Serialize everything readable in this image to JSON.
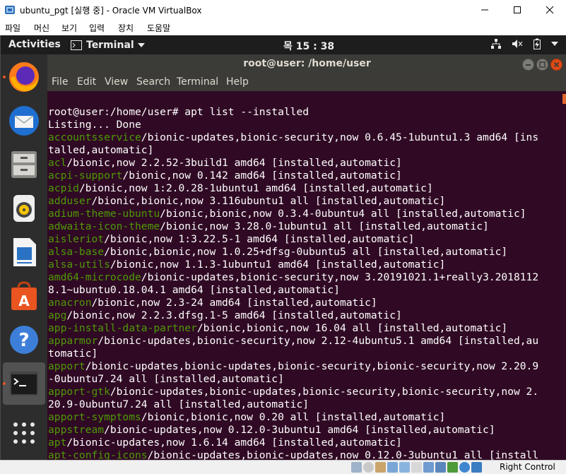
{
  "vbox": {
    "title": "ubuntu_pgt [실행 중] - Oracle VM VirtualBox",
    "menu": [
      "파일",
      "머신",
      "보기",
      "입력",
      "장치",
      "도움말"
    ],
    "host_key": "Right Control"
  },
  "gnome": {
    "activities": "Activities",
    "app_menu": "Terminal",
    "clock": "목 15 : 38"
  },
  "dock": {
    "items": [
      "firefox-icon",
      "thunderbird-icon",
      "files-icon",
      "rhythmbox-icon",
      "libreoffice-writer-icon",
      "ubuntu-software-icon",
      "help-icon",
      "terminal-icon",
      "show-applications-icon"
    ]
  },
  "terminal": {
    "title": "root@user: /home/user",
    "menu": [
      "File",
      "Edit",
      "View",
      "Search",
      "Terminal",
      "Help"
    ],
    "lines": [
      {
        "pkg": "",
        "rest": "root@user:/home/user# apt list --installed"
      },
      {
        "pkg": "",
        "rest": "Listing... Done"
      },
      {
        "pkg": "accountsservice",
        "rest": "/bionic-updates,bionic-security,now 0.6.45-1ubuntu1.3 amd64 [ins"
      },
      {
        "pkg": "",
        "rest": "talled,automatic]"
      },
      {
        "pkg": "acl",
        "rest": "/bionic,now 2.2.52-3build1 amd64 [installed,automatic]"
      },
      {
        "pkg": "acpi-support",
        "rest": "/bionic,now 0.142 amd64 [installed,automatic]"
      },
      {
        "pkg": "acpid",
        "rest": "/bionic,now 1:2.0.28-1ubuntu1 amd64 [installed,automatic]"
      },
      {
        "pkg": "adduser",
        "rest": "/bionic,bionic,now 3.116ubuntu1 all [installed,automatic]"
      },
      {
        "pkg": "adium-theme-ubuntu",
        "rest": "/bionic,bionic,now 0.3.4-0ubuntu4 all [installed,automatic]"
      },
      {
        "pkg": "adwaita-icon-theme",
        "rest": "/bionic,now 3.28.0-1ubuntu1 all [installed,automatic]"
      },
      {
        "pkg": "aisleriot",
        "rest": "/bionic,now 1:3.22.5-1 amd64 [installed,automatic]"
      },
      {
        "pkg": "alsa-base",
        "rest": "/bionic,bionic,now 1.0.25+dfsg-0ubuntu5 all [installed,automatic]"
      },
      {
        "pkg": "alsa-utils",
        "rest": "/bionic,now 1.1.3-1ubuntu1 amd64 [installed,automatic]"
      },
      {
        "pkg": "amd64-microcode",
        "rest": "/bionic-updates,bionic-security,now 3.20191021.1+really3.2018112"
      },
      {
        "pkg": "",
        "rest": "8.1~ubuntu0.18.04.1 amd64 [installed,automatic]"
      },
      {
        "pkg": "anacron",
        "rest": "/bionic,now 2.3-24 amd64 [installed,automatic]"
      },
      {
        "pkg": "apg",
        "rest": "/bionic,now 2.2.3.dfsg.1-5 amd64 [installed,automatic]"
      },
      {
        "pkg": "app-install-data-partner",
        "rest": "/bionic,bionic,now 16.04 all [installed,automatic]"
      },
      {
        "pkg": "apparmor",
        "rest": "/bionic-updates,bionic-security,now 2.12-4ubuntu5.1 amd64 [installed,au"
      },
      {
        "pkg": "",
        "rest": "tomatic]"
      },
      {
        "pkg": "apport",
        "rest": "/bionic-updates,bionic-updates,bionic-security,bionic-security,now 2.20.9"
      },
      {
        "pkg": "",
        "rest": "-0ubuntu7.24 all [installed,automatic]"
      },
      {
        "pkg": "apport-gtk",
        "rest": "/bionic-updates,bionic-updates,bionic-security,bionic-security,now 2."
      },
      {
        "pkg": "",
        "rest": "20.9-0ubuntu7.24 all [installed,automatic]"
      },
      {
        "pkg": "apport-symptoms",
        "rest": "/bionic,bionic,now 0.20 all [installed,automatic]"
      },
      {
        "pkg": "appstream",
        "rest": "/bionic-updates,now 0.12.0-3ubuntu1 amd64 [installed,automatic]"
      },
      {
        "pkg": "apt",
        "rest": "/bionic-updates,now 1.6.14 amd64 [installed,automatic]"
      },
      {
        "pkg": "apt-config-icons",
        "rest": "/bionic-updates,bionic-updates,now 0.12.0-3ubuntu1 all [install"
      }
    ]
  },
  "colors": {
    "terminal_bg": "#300a24",
    "package_green": "#4e9a06",
    "ubuntu_orange": "#e95420"
  }
}
